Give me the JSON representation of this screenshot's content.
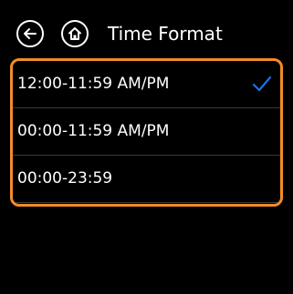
{
  "header": {
    "title": "Time Format"
  },
  "options": [
    {
      "label": "12:00-11:59 AM/PM",
      "selected": true
    },
    {
      "label": "00:00-11:59 AM/PM",
      "selected": false
    },
    {
      "label": "00:00-23:59",
      "selected": false
    }
  ],
  "colors": {
    "background": "#000000",
    "text": "#ffffff",
    "highlight_border": "#f28c28",
    "checkmark": "#1a73e8",
    "divider": "#3a3a3a"
  },
  "icons": {
    "back": "arrow-left-icon",
    "home": "home-icon",
    "selected": "checkmark-icon"
  }
}
